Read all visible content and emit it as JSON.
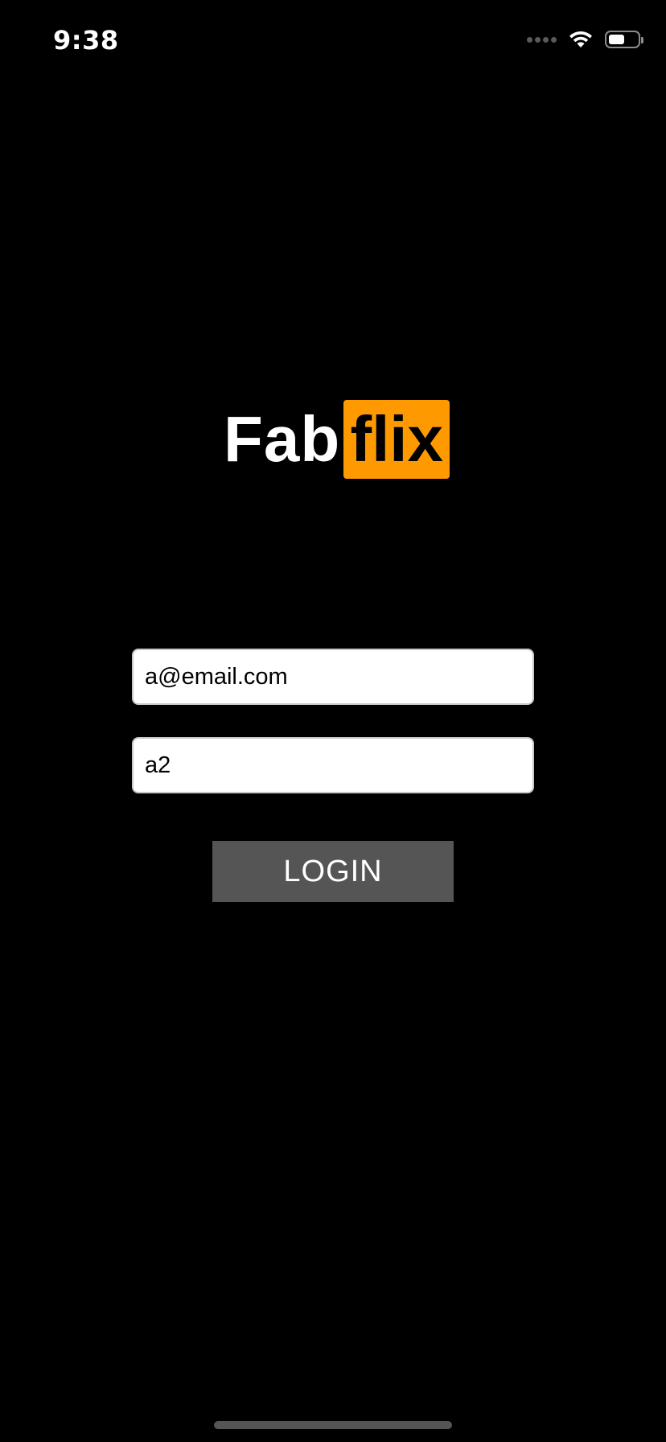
{
  "status_bar": {
    "time": "9:38",
    "battery_level": 0.55,
    "icons": [
      "cellular-signal-icon",
      "wifi-icon",
      "battery-icon"
    ]
  },
  "logo": {
    "part1": "Fab",
    "part2": "flix",
    "accent_color": "#ff9900"
  },
  "login_form": {
    "email_value": "a@email.com",
    "password_value": "a2",
    "login_label": "LOGIN"
  },
  "colors": {
    "background": "#000000",
    "button": "#555555",
    "accent": "#ff9900"
  }
}
